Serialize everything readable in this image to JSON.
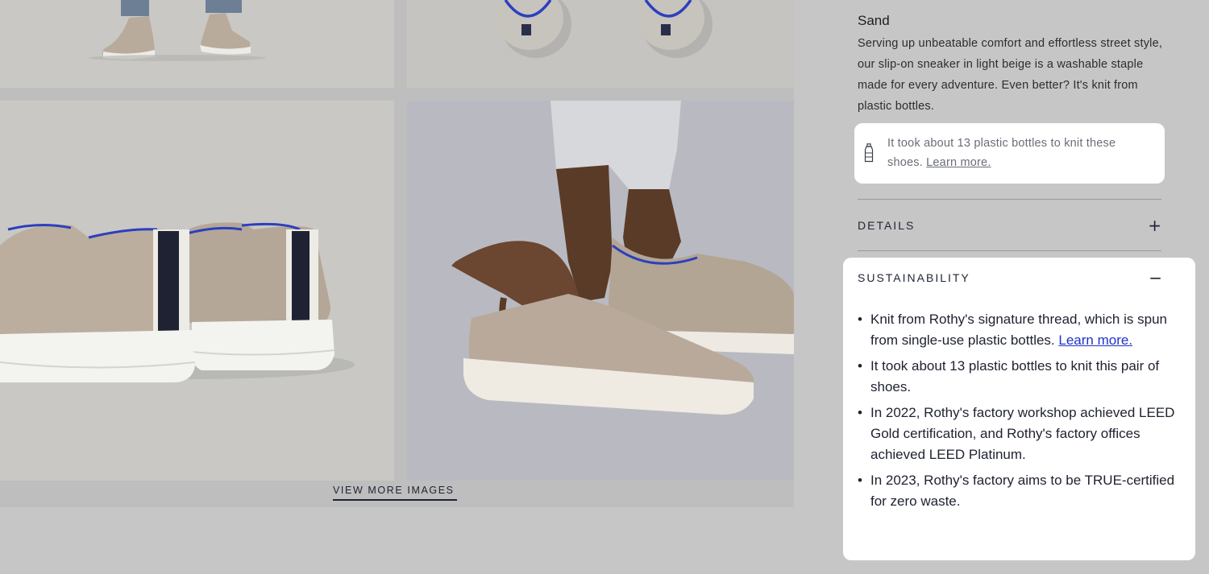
{
  "product": {
    "color_name": "Sand",
    "description": "Serving up unbeatable comfort and effortless street style, our slip-on sneaker in light beige is a washable staple made for every adventure. Even better? It's knit from plastic bottles."
  },
  "callout": {
    "icon": "bottle-icon",
    "text": "It took about 13 plastic bottles to knit these shoes.",
    "link": "Learn more."
  },
  "gallery": {
    "view_more_label": "VIEW MORE IMAGES"
  },
  "details": {
    "title": "DETAILS",
    "toggle": "+"
  },
  "sustainability": {
    "title": "SUSTAINABILITY",
    "toggle": "−",
    "bullets": [
      {
        "text": "Knit from Rothy's signature thread, which is spun from single-use plastic bottles. ",
        "link": "Learn more."
      },
      {
        "text": "It took about 13 plastic bottles to knit this pair of shoes.",
        "link": ""
      },
      {
        "text": "In 2022, Rothy's factory workshop achieved LEED Gold certification, and Rothy's factory offices achieved LEED Platinum.",
        "link": ""
      },
      {
        "text": "In 2023, Rothy's factory aims to be TRUE-certified for zero waste.",
        "link": ""
      }
    ]
  },
  "colors": {
    "shoe_beige": "#b7a89a",
    "sole_white": "#f2f2ef",
    "accent_blue": "#2c3fbf",
    "link_blue": "#1e33c8",
    "overlay_gray": "#c6c6c6"
  }
}
